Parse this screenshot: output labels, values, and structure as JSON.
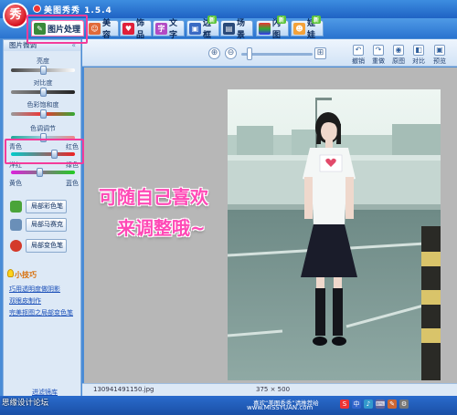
{
  "app": {
    "title": "美图秀秀 1.5.4",
    "logo_char": "秀"
  },
  "tabs": [
    {
      "label": "图片处理",
      "active": true
    },
    {
      "label": "美容"
    },
    {
      "label": "饰品"
    },
    {
      "label": "文字"
    },
    {
      "label": "边框",
      "badge": "新"
    },
    {
      "label": "场景"
    },
    {
      "label": "闪图",
      "badge": "新"
    },
    {
      "label": "娃娃",
      "badge": "新"
    }
  ],
  "left_panel": {
    "header": "图片微调",
    "collapse": "«",
    "sliders": [
      {
        "label": "亮度",
        "level": 0.5
      },
      {
        "label": "对比度",
        "level": 0.5
      },
      {
        "label": "色彩饱和度",
        "level": 0.5
      },
      {
        "label": "色调调节",
        "level": 0.5
      }
    ],
    "color_sliders": [
      {
        "left": "青色",
        "right": "红色",
        "level": 0.7
      },
      {
        "left": "洋红",
        "right": "绿色",
        "level": 0.45
      },
      {
        "left": "黄色",
        "right": "蓝色",
        "level": 0.5
      }
    ],
    "buttons": [
      {
        "label": "局部彩色笔",
        "icon_color": "#4aa43a"
      },
      {
        "label": "局部马赛克",
        "icon_color": "#6a8fb8"
      },
      {
        "label": "局部变色笔",
        "icon_color": "#d43a2a"
      }
    ],
    "tips_title": "小技巧",
    "tips": [
      "巧用透明度做阴影",
      "双眼皮制作",
      "完美抠图之局部变色笔"
    ],
    "gallery": "进滤镜库"
  },
  "toolbar": {
    "zoom_in": "⊕",
    "zoom_out": "⊖",
    "fit": "⊞",
    "zoom_level": 0.08,
    "tools": [
      {
        "label": "撤销",
        "glyph": "↶"
      },
      {
        "label": "重做",
        "glyph": "↷"
      },
      {
        "label": "原图",
        "glyph": "◉"
      },
      {
        "label": "对比",
        "glyph": "◧"
      },
      {
        "label": "预览",
        "glyph": "▣"
      }
    ]
  },
  "canvas": {
    "annotation_line1": "可随自己喜欢",
    "annotation_line2": "来调整哦~"
  },
  "footer": {
    "filename": "130941491150.jpg",
    "dimensions": "375 × 500",
    "status": "喜欢“美图秀秀”请推荐给",
    "watermark_left": "思缘设计论坛",
    "watermark_right": "www.MISSYUAN.com",
    "ime": [
      "S",
      "中",
      "♪",
      "⌨",
      "✎",
      "⚙"
    ]
  },
  "colors": {
    "accent_pink": "#f43c9a",
    "annotation_pink": "#ff49b6",
    "chrome_blue": "#2a73cf"
  }
}
